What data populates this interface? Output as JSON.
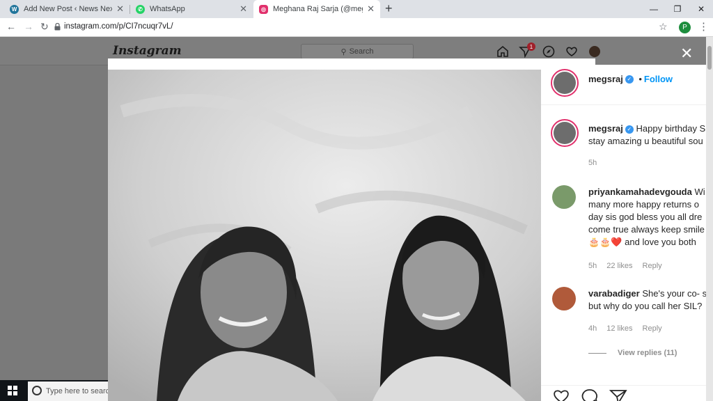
{
  "browser": {
    "tabs": [
      {
        "title": "Add New Post ‹ News Next — W",
        "icon": "wordpress-icon",
        "color": "#21759b",
        "active": false
      },
      {
        "title": "WhatsApp",
        "icon": "whatsapp-icon",
        "color": "#25d366",
        "active": false
      },
      {
        "title": "Meghana Raj Sarja (@megsraj) •",
        "icon": "instagram-icon",
        "color": "#e1306c",
        "active": true
      }
    ],
    "url": "instagram.com/p/CI7ncuqr7vL/",
    "profile_initial": "P"
  },
  "instagram": {
    "logo": "Instagram",
    "search_placeholder": "Search",
    "notification_count": "1",
    "post": {
      "owner": "megsraj",
      "follow_label": "Follow",
      "caption": {
        "user": "megsraj",
        "lines": [
          "Happy birthday S",
          "stay amazing u beautiful sou"
        ],
        "time": "5h"
      },
      "comments": [
        {
          "user": "priyankamahadevgouda",
          "lines": [
            "Wi",
            "many more happy returns o",
            "day sis god bless you all dre",
            "come true always keep smile",
            "🎂🎂❤️ and love you both"
          ],
          "time": "5h",
          "likes": "22 likes",
          "reply": "Reply"
        },
        {
          "user": "varabadiger",
          "lines": [
            "She's your co- s",
            "but why do you call her SIL?"
          ],
          "time": "4h",
          "likes": "12 likes",
          "reply": "Reply",
          "view_replies": "View replies (11)"
        }
      ]
    }
  },
  "taskbar": {
    "search_placeholder": "Type here to search"
  }
}
